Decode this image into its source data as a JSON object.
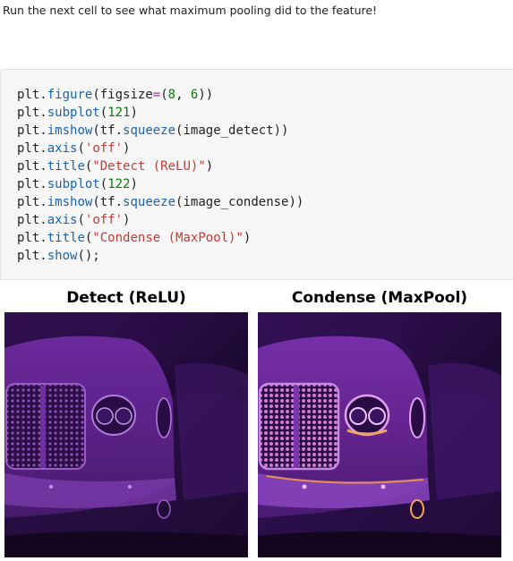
{
  "markdown": {
    "text": "Run the next cell to see what maximum pooling did to the feature!"
  },
  "code_cell": {
    "lines": [
      [
        {
          "t": "id",
          "v": "plt"
        },
        {
          "t": "id",
          "v": "."
        },
        {
          "t": "fn",
          "v": "figure"
        },
        {
          "t": "id",
          "v": "(figsize"
        },
        {
          "t": "op",
          "v": "="
        },
        {
          "t": "id",
          "v": "("
        },
        {
          "t": "num",
          "v": "8"
        },
        {
          "t": "id",
          "v": ", "
        },
        {
          "t": "num",
          "v": "6"
        },
        {
          "t": "id",
          "v": "))"
        }
      ],
      [
        {
          "t": "id",
          "v": "plt"
        },
        {
          "t": "id",
          "v": "."
        },
        {
          "t": "fn",
          "v": "subplot"
        },
        {
          "t": "id",
          "v": "("
        },
        {
          "t": "num",
          "v": "121"
        },
        {
          "t": "id",
          "v": ")"
        }
      ],
      [
        {
          "t": "id",
          "v": "plt"
        },
        {
          "t": "id",
          "v": "."
        },
        {
          "t": "fn",
          "v": "imshow"
        },
        {
          "t": "id",
          "v": "(tf."
        },
        {
          "t": "fn",
          "v": "squeeze"
        },
        {
          "t": "id",
          "v": "(image_detect))"
        }
      ],
      [
        {
          "t": "id",
          "v": "plt"
        },
        {
          "t": "id",
          "v": "."
        },
        {
          "t": "fn",
          "v": "axis"
        },
        {
          "t": "id",
          "v": "("
        },
        {
          "t": "str",
          "v": "'off'"
        },
        {
          "t": "id",
          "v": ")"
        }
      ],
      [
        {
          "t": "id",
          "v": "plt"
        },
        {
          "t": "id",
          "v": "."
        },
        {
          "t": "fn",
          "v": "title"
        },
        {
          "t": "id",
          "v": "("
        },
        {
          "t": "str",
          "v": "\"Detect (ReLU)\""
        },
        {
          "t": "id",
          "v": ")"
        }
      ],
      [
        {
          "t": "id",
          "v": "plt"
        },
        {
          "t": "id",
          "v": "."
        },
        {
          "t": "fn",
          "v": "subplot"
        },
        {
          "t": "id",
          "v": "("
        },
        {
          "t": "num",
          "v": "122"
        },
        {
          "t": "id",
          "v": ")"
        }
      ],
      [
        {
          "t": "id",
          "v": "plt"
        },
        {
          "t": "id",
          "v": "."
        },
        {
          "t": "fn",
          "v": "imshow"
        },
        {
          "t": "id",
          "v": "(tf."
        },
        {
          "t": "fn",
          "v": "squeeze"
        },
        {
          "t": "id",
          "v": "(image_condense))"
        }
      ],
      [
        {
          "t": "id",
          "v": "plt"
        },
        {
          "t": "id",
          "v": "."
        },
        {
          "t": "fn",
          "v": "axis"
        },
        {
          "t": "id",
          "v": "("
        },
        {
          "t": "str",
          "v": "'off'"
        },
        {
          "t": "id",
          "v": ")"
        }
      ],
      [
        {
          "t": "id",
          "v": "plt"
        },
        {
          "t": "id",
          "v": "."
        },
        {
          "t": "fn",
          "v": "title"
        },
        {
          "t": "id",
          "v": "("
        },
        {
          "t": "str",
          "v": "\"Condense (MaxPool)\""
        },
        {
          "t": "id",
          "v": ")"
        }
      ],
      [
        {
          "t": "id",
          "v": "plt"
        },
        {
          "t": "id",
          "v": "."
        },
        {
          "t": "fn",
          "v": "show"
        },
        {
          "t": "id",
          "v": "();"
        }
      ]
    ]
  },
  "output": {
    "left_title": "Detect (ReLU)",
    "right_title": "Condense (MaxPool)",
    "left_image_icon": "car-grille-feature-map-icon",
    "right_image_icon": "car-grille-pooled-map-icon",
    "colormap": "magma"
  },
  "colors": {
    "cell_background": "#f7f7f7",
    "function": "#1a63a8",
    "string": "#c33a35",
    "number": "#0a7a0a",
    "operator": "#a0329f"
  }
}
